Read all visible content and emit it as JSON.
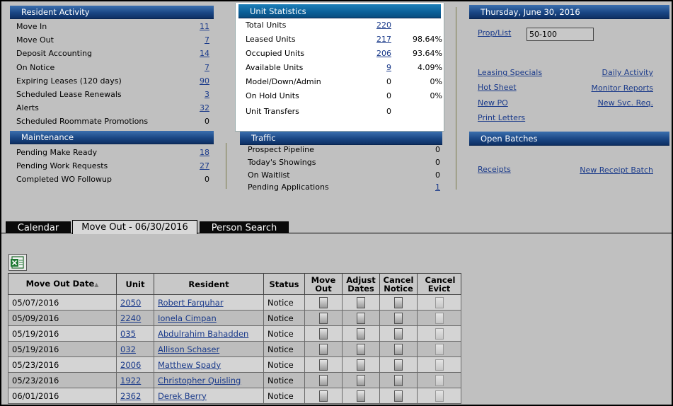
{
  "resident_activity": {
    "title": "Resident Activity",
    "rows": [
      {
        "label": "Move In",
        "value": "11",
        "link": true
      },
      {
        "label": "Move Out",
        "value": "7",
        "link": true
      },
      {
        "label": "Deposit Accounting",
        "value": "14",
        "link": true
      },
      {
        "label": "On Notice",
        "value": "7",
        "link": true
      },
      {
        "label": "Expiring Leases (120 days)",
        "value": "90",
        "link": true
      },
      {
        "label": "Scheduled Lease Renewals",
        "value": "3",
        "link": true
      },
      {
        "label": "Alerts",
        "value": "32",
        "link": true
      },
      {
        "label": "Scheduled Roommate Promotions",
        "value": "0",
        "link": false
      }
    ]
  },
  "maintenance": {
    "title": "Maintenance",
    "rows": [
      {
        "label": "Pending Make Ready",
        "value": "18",
        "link": true
      },
      {
        "label": "Pending Work Requests",
        "value": "27",
        "link": true
      },
      {
        "label": "Completed WO Followup",
        "value": "0",
        "link": false
      }
    ]
  },
  "unit_statistics": {
    "title": "Unit Statistics",
    "rows": [
      {
        "label": "Total Units",
        "value": "220",
        "pct": "",
        "link": true
      },
      {
        "label": "Leased Units",
        "value": "217",
        "pct": "98.64%",
        "link": true
      },
      {
        "label": "Occupied Units",
        "value": "206",
        "pct": "93.64%",
        "link": true
      },
      {
        "label": "Available Units",
        "value": "9",
        "pct": "4.09%",
        "link": true
      },
      {
        "label": "Model/Down/Admin",
        "value": "0",
        "pct": "0%",
        "link": false
      },
      {
        "label": "On Hold Units",
        "value": "0",
        "pct": "0%",
        "link": false
      },
      {
        "label": "Unit Transfers",
        "value": "0",
        "pct": "",
        "link": false
      }
    ]
  },
  "traffic": {
    "title": "Traffic",
    "rows": [
      {
        "label": "Prospect Pipeline",
        "value": "0",
        "link": false
      },
      {
        "label": "Today's Showings",
        "value": "0",
        "link": false
      },
      {
        "label": "On Waitlist",
        "value": "0",
        "link": false
      },
      {
        "label": "Pending Applications",
        "value": "1",
        "link": true
      }
    ]
  },
  "date_panel": {
    "title": "Thursday, June 30, 2016",
    "prop_list_label": "Prop/List",
    "prop_list_value": "50-100",
    "links_left": [
      "Leasing Specials",
      "Hot Sheet",
      "New PO",
      "Print Letters"
    ],
    "links_right": [
      "Daily Activity",
      "Monitor Reports",
      "New Svc. Req."
    ]
  },
  "open_batches": {
    "title": "Open Batches",
    "left_link": "Receipts",
    "right_link": "New Receipt Batch"
  },
  "tabs": [
    "Calendar",
    "Move Out - 06/30/2016",
    "Person Search"
  ],
  "grid": {
    "columns": [
      "Move Out Date",
      "Unit",
      "Resident",
      "Status",
      "Move Out",
      "Adjust Dates",
      "Cancel Notice",
      "Cancel Evict"
    ],
    "sort_indicator": "▲",
    "rows": [
      {
        "date": "05/07/2016",
        "unit": "2050",
        "resident": "Robert Farquhar",
        "status": "Notice"
      },
      {
        "date": "05/09/2016",
        "unit": "2240",
        "resident": "Ionela Cimpan",
        "status": "Notice"
      },
      {
        "date": "05/19/2016",
        "unit": "035",
        "resident": "Abdulrahim Bahadden",
        "status": "Notice"
      },
      {
        "date": "05/19/2016",
        "unit": "032",
        "resident": "Allison Schaser",
        "status": "Notice"
      },
      {
        "date": "05/23/2016",
        "unit": "2006",
        "resident": "Matthew Spady",
        "status": "Notice"
      },
      {
        "date": "05/23/2016",
        "unit": "1922",
        "resident": "Christopher Quisling",
        "status": "Notice"
      },
      {
        "date": "06/01/2016",
        "unit": "2362",
        "resident": "Derek Berry",
        "status": "Notice"
      }
    ]
  },
  "icons": {
    "export": "excel-export-icon"
  },
  "colors": {
    "header": "#1a4785",
    "unit_stats_header": "#0b5f98",
    "background": "#c0c0c0",
    "link": "#1a3a8a"
  }
}
